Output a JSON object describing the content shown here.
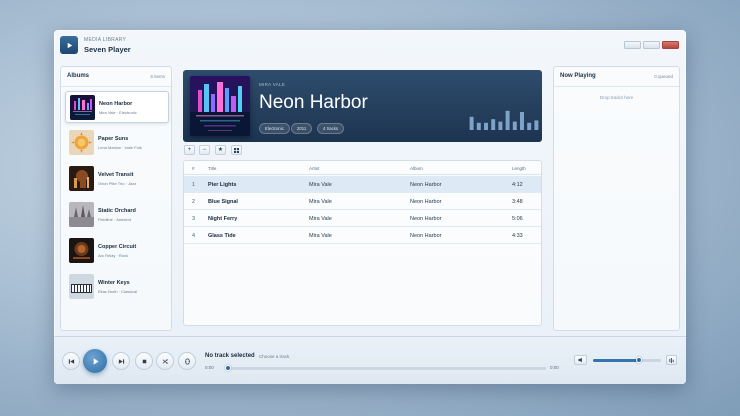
{
  "app": {
    "kicker": "MEDIA LIBRARY",
    "title": "Seven Player"
  },
  "albums_panel": {
    "title": "Albums",
    "count": "6 items"
  },
  "albums": [
    {
      "name": "Neon Harbor",
      "sub": "Mira Vale · Electronic",
      "active": true
    },
    {
      "name": "Paper Suns",
      "sub": "Lena Marlow · Indie Folk",
      "active": false
    },
    {
      "name": "Velvet Transit",
      "sub": "Orion Pike Trio · Jazz",
      "active": false
    },
    {
      "name": "Static Orchard",
      "sub": "Fieldline · Ambient",
      "active": false
    },
    {
      "name": "Copper Circuit",
      "sub": "Arc Relay · Rock",
      "active": false
    },
    {
      "name": "Winter Keys",
      "sub": "Elias North · Classical",
      "active": false
    }
  ],
  "hero": {
    "artist": "MIRA VALE",
    "title": "Neon Harbor",
    "chips": [
      "Electronic",
      "2011",
      "4 tracks"
    ],
    "eq_levels": [
      0.55,
      0.3,
      0.3,
      0.45,
      0.35,
      0.8,
      0.35,
      0.75,
      0.3,
      0.4
    ]
  },
  "toolbar": {
    "add": "+",
    "remove": "−",
    "favorite": "★",
    "view": "grid"
  },
  "table": {
    "headers": {
      "num": "#",
      "title": "Title",
      "artist": "Artist",
      "album": "Album",
      "length": "Length"
    },
    "rows": [
      {
        "num": "1",
        "title": "Pier Lights",
        "artist": "Mira Vale",
        "album": "Neon Harbor",
        "length": "4:12",
        "selected": true
      },
      {
        "num": "2",
        "title": "Blue Signal",
        "artist": "Mira Vale",
        "album": "Neon Harbor",
        "length": "3:48",
        "selected": false
      },
      {
        "num": "3",
        "title": "Night Ferry",
        "artist": "Mira Vale",
        "album": "Neon Harbor",
        "length": "5:06",
        "selected": false
      },
      {
        "num": "4",
        "title": "Glass Tide",
        "artist": "Mira Vale",
        "album": "Neon Harbor",
        "length": "4:33",
        "selected": false
      }
    ]
  },
  "now_playing": {
    "title": "Now Playing",
    "count": "0 queued",
    "empty": "Drop tracks here"
  },
  "player": {
    "track": "No track selected",
    "hint": "Choose a track",
    "time_elapsed": "0:00",
    "time_total": "0:00",
    "progress": 0,
    "volume": 0.68
  },
  "colors": {
    "accent": "#2d6aa4",
    "hero_bg": "#1d3450",
    "close": "#b5463d"
  }
}
